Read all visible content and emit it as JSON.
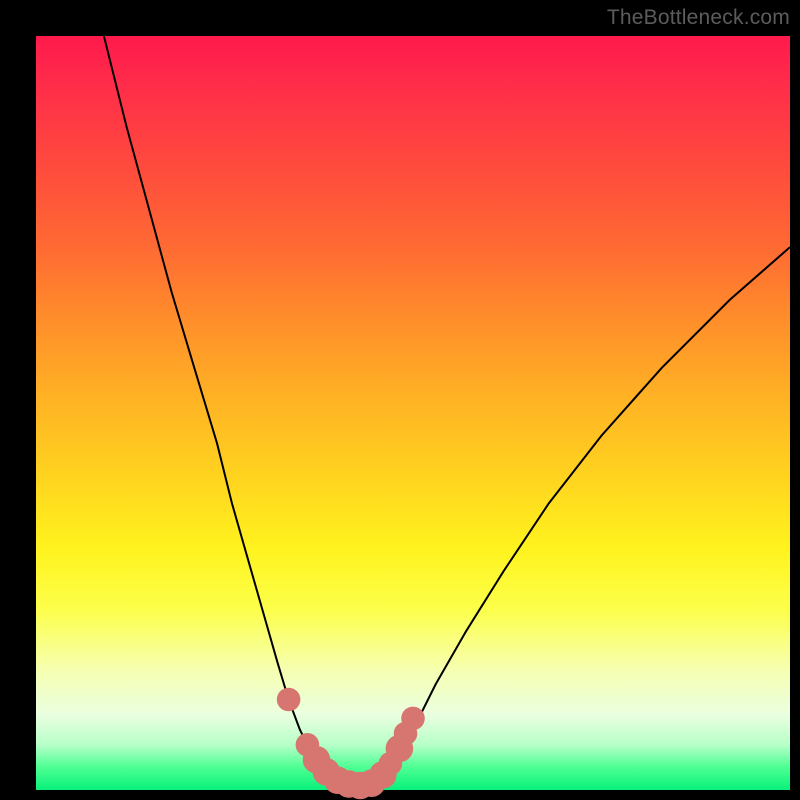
{
  "watermark": "TheBottleneck.com",
  "colors": {
    "frame": "#000000",
    "curve": "#000000",
    "marker": "#d77670",
    "gradient_top": "#ff1a4d",
    "gradient_bottom": "#08f07a"
  },
  "chart_data": {
    "type": "line",
    "title": "",
    "xlabel": "",
    "ylabel": "",
    "xlim": [
      0,
      100
    ],
    "ylim": [
      0,
      100
    ],
    "series": [
      {
        "name": "bottleneck-curve",
        "x": [
          9,
          12,
          15,
          18,
          21,
          24,
          26,
          28,
          30,
          32,
          33.5,
          35,
          36,
          37,
          38,
          39,
          40,
          41,
          42,
          43,
          44,
          45,
          46,
          48,
          50,
          53,
          57,
          62,
          68,
          75,
          83,
          92,
          100
        ],
        "y": [
          100,
          88,
          77,
          66,
          56,
          46,
          38,
          31,
          24,
          17,
          12,
          8,
          6,
          4.5,
          3.2,
          2.2,
          1.5,
          1.0,
          0.7,
          0.5,
          0.6,
          1.0,
          1.8,
          4,
          8,
          14,
          21,
          29,
          38,
          47,
          56,
          65,
          72
        ]
      }
    ],
    "markers": {
      "name": "highlight-points",
      "points": [
        {
          "x": 33.5,
          "y": 12,
          "r": 1.0
        },
        {
          "x": 36,
          "y": 6,
          "r": 1.0
        },
        {
          "x": 37.2,
          "y": 4,
          "r": 1.3
        },
        {
          "x": 38.5,
          "y": 2.4,
          "r": 1.3
        },
        {
          "x": 40,
          "y": 1.3,
          "r": 1.3
        },
        {
          "x": 41.5,
          "y": 0.8,
          "r": 1.3
        },
        {
          "x": 43,
          "y": 0.6,
          "r": 1.3
        },
        {
          "x": 44.5,
          "y": 0.9,
          "r": 1.3
        },
        {
          "x": 46,
          "y": 2.0,
          "r": 1.3
        },
        {
          "x": 47,
          "y": 3.5,
          "r": 1.0
        },
        {
          "x": 48.2,
          "y": 5.5,
          "r": 1.3
        },
        {
          "x": 49,
          "y": 7.5,
          "r": 1.0
        },
        {
          "x": 50,
          "y": 9.5,
          "r": 1.0
        }
      ]
    }
  }
}
